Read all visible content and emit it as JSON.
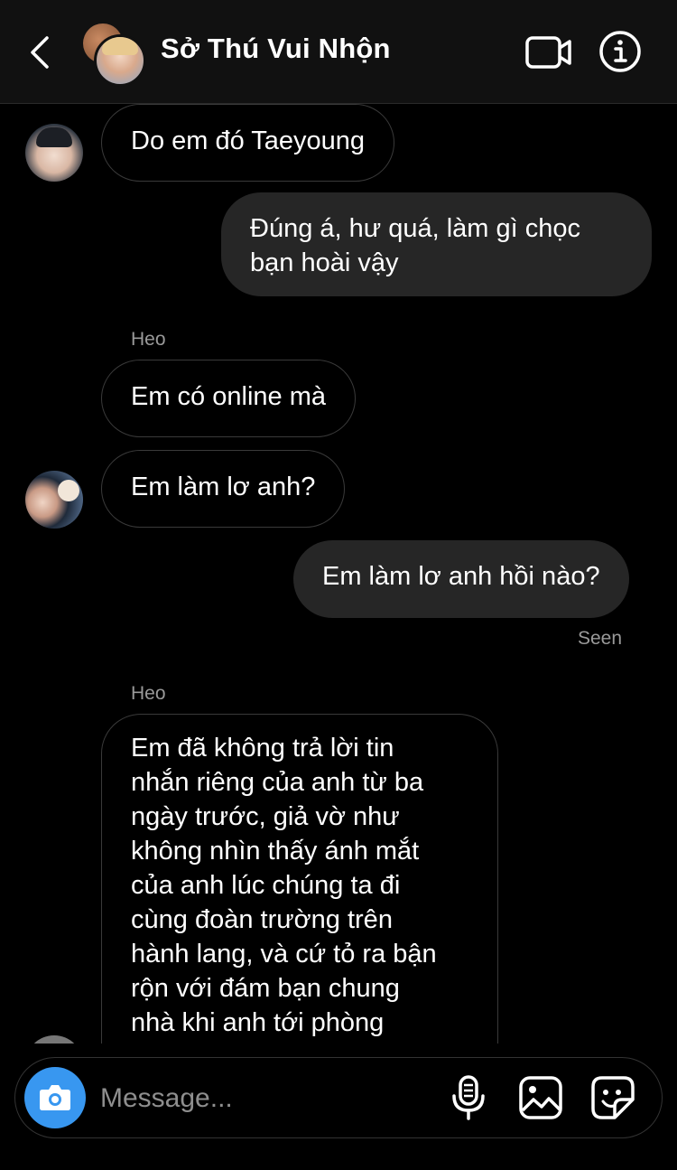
{
  "header": {
    "title": "Sở Thú Vui Nhộn",
    "back_icon": "chevron-left-icon",
    "video_icon": "video-camera-icon",
    "info_icon": "info-icon"
  },
  "messages": [
    {
      "direction": "incoming",
      "text": "Do em đó Taeyoung"
    },
    {
      "direction": "outgoing",
      "lines": [
        "Đúng á, hư quá, làm gì chọc",
        "bạn hoài vậy"
      ]
    },
    {
      "direction": "incoming",
      "sender": "Heo",
      "text": "Em có online mà"
    },
    {
      "direction": "incoming",
      "text": "Em làm lơ anh?"
    },
    {
      "direction": "outgoing",
      "text": "Em làm lơ anh hồi nào?"
    },
    {
      "direction": "incoming",
      "sender": "Heo",
      "lines": [
        "Em đã không trả lời tin",
        "nhắn riêng của anh từ ba",
        "ngày trước, giả vờ như",
        "không nhìn thấy ánh mắt",
        "của anh lúc chúng ta đi",
        "cùng đoàn trường trên",
        "hành lang, và cứ tỏ ra bận",
        "rộn với đám bạn chung",
        "nhà khi anh tới phòng"
      ]
    }
  ],
  "seen_label": "Seen",
  "composer": {
    "placeholder": "Message...",
    "camera_icon": "camera-icon",
    "mic_icon": "microphone-icon",
    "gallery_icon": "gallery-icon",
    "sticker_icon": "sticker-icon"
  },
  "colors": {
    "background": "#000000",
    "header": "#111111",
    "outgoing_bubble": "#262626",
    "incoming_border": "#3a3a3a",
    "accent": "#3897f0"
  }
}
